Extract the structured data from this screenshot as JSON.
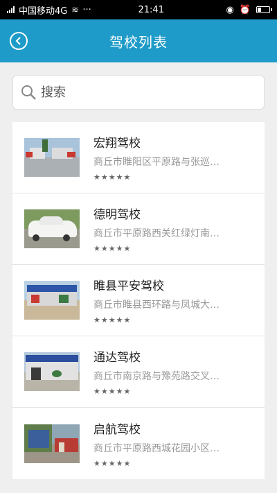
{
  "status": {
    "carrier": "中国移动4G",
    "time": "21:41"
  },
  "nav": {
    "title": "驾校列表"
  },
  "search": {
    "placeholder": "搜索"
  },
  "schools": [
    {
      "name": "宏翔驾校",
      "address": "商丘市睢阳区平原路与张巡…",
      "rating": "★★★★★"
    },
    {
      "name": "德明驾校",
      "address": "商丘市平原路西关红绿灯南…",
      "rating": "★★★★★"
    },
    {
      "name": "睢县平安驾校",
      "address": "商丘市睢县西环路与凤城大…",
      "rating": "★★★★★"
    },
    {
      "name": "通达驾校",
      "address": "商丘市南京路与豫苑路交叉…",
      "rating": "★★★★★"
    },
    {
      "name": "启航驾校",
      "address": "商丘市平原路西城花园小区…",
      "rating": "★★★★★"
    }
  ]
}
